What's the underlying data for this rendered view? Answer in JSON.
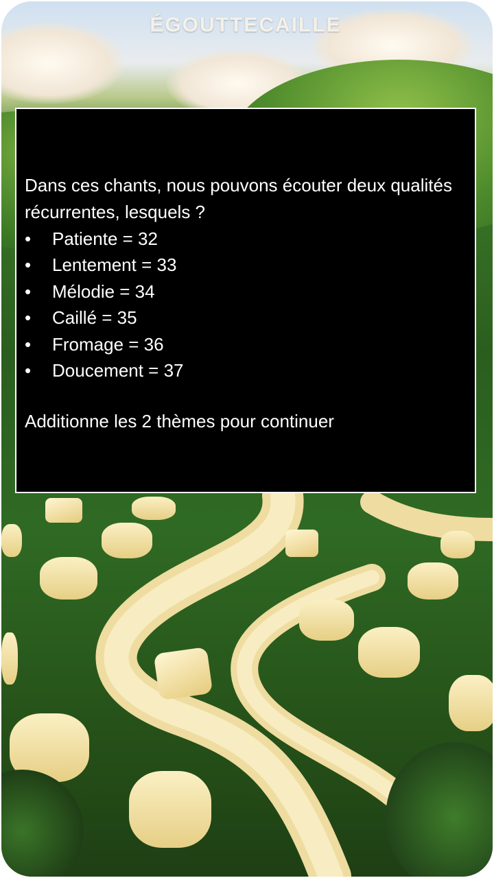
{
  "logo": {
    "text": "ÉGOUTTECAILLE"
  },
  "panel": {
    "question": "Dans ces chants, nous pouvons écouter deux qualités récurrentes, lesquels ?",
    "options": [
      {
        "bullet": "•",
        "label": "Patiente  = 32"
      },
      {
        "bullet": "•",
        "label": "Lentement = 33"
      },
      {
        "bullet": "•",
        "label": "Mélodie = 34"
      },
      {
        "bullet": "•",
        "label": "Caillé = 35"
      },
      {
        "bullet": "•",
        "label": "Fromage = 36"
      },
      {
        "bullet": "•",
        "label": "Doucement = 37"
      }
    ],
    "instruction": "Additionne les 2 thèmes pour continuer"
  },
  "colors": {
    "panel_bg": "#000000",
    "panel_border": "#ffffff",
    "text": "#ffffff",
    "grass": "#2f6a24",
    "cheese": "#f3e3a3"
  }
}
